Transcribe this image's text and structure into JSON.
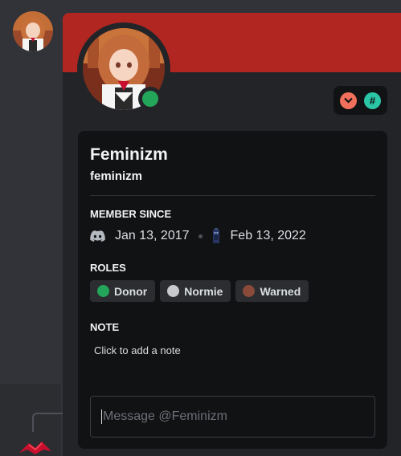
{
  "profile": {
    "display_name": "Feminizm",
    "username": "feminizm",
    "status": "online",
    "banner_color": "#b12621",
    "status_color": "#23a55a"
  },
  "badges": [
    {
      "icon": "chevron-down-badge-icon",
      "color": "#f0705b"
    },
    {
      "icon": "hashtag-badge-icon",
      "color": "#2bc6a5"
    }
  ],
  "member_since": {
    "title": "MEMBER SINCE",
    "discord_icon": "discord-icon",
    "discord_date": "Jan 13, 2017",
    "server_icon": "server-icon",
    "server_date": "Feb 13, 2022"
  },
  "roles": {
    "title": "ROLES",
    "items": [
      {
        "name": "Donor",
        "color": "#23a55a"
      },
      {
        "name": "Normie",
        "color": "#c7c9cd"
      },
      {
        "name": "Warned",
        "color": "#8a4a3a"
      }
    ]
  },
  "note": {
    "title": "NOTE",
    "placeholder": "Click to add a note"
  },
  "message": {
    "placeholder": "Message @Feminizm"
  }
}
